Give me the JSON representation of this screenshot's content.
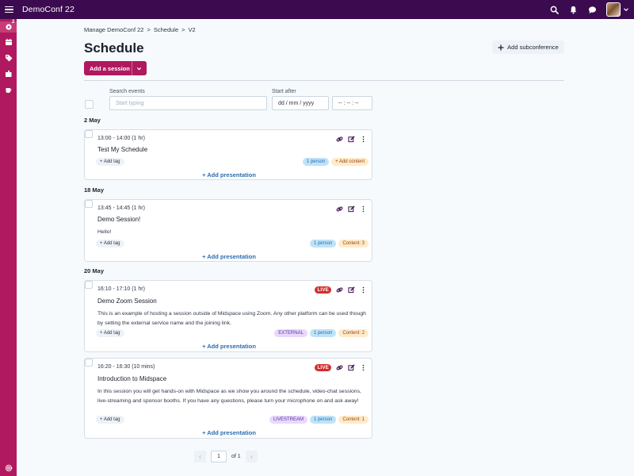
{
  "app": {
    "title": "DemoConf 22"
  },
  "rail": {
    "badge_count": "2"
  },
  "breadcrumb": [
    "Manage DemoConf 22",
    ">",
    "Schedule",
    ">",
    "V2"
  ],
  "page": {
    "title": "Schedule",
    "add_subconference": "Add subconference",
    "add_session": "Add a session"
  },
  "filters": {
    "search_label": "Search events",
    "search_placeholder": "Start typing",
    "start_after_label": "Start after",
    "date_placeholder": "dd / mm / yyyy",
    "time_placeholder": "-- : -- : --"
  },
  "groups": [
    {
      "date": "2 May",
      "sessions": [
        {
          "time": "13:00 - 14:00 (1 hr)",
          "title": "Test My Schedule",
          "description": "",
          "add_tag": "+ Add tag",
          "pills": [
            "1 person",
            "+ Add content"
          ],
          "add_presentation": "Add presentation"
        }
      ]
    },
    {
      "date": "18 May",
      "sessions": [
        {
          "time": "13:45 - 14:45 (1 hr)",
          "title": "Demo Session!",
          "description": "Hello!",
          "add_tag": "+ Add tag",
          "pills": [
            "1 person",
            "Content: 3"
          ],
          "add_presentation": "Add presentation"
        }
      ]
    },
    {
      "date": "20 May",
      "sessions": [
        {
          "time": "16:10 - 17:10 (1 hr)",
          "title": "Demo Zoom Session",
          "live": "LIVE",
          "description": "This is an example of hosting a session outside of Midspace using Zoom. Any other platform can be used though by setting the external service name and the joining link.",
          "add_tag": "+ Add tag",
          "pills": [
            "EXTERNAL",
            "1 person",
            "Content: 2"
          ],
          "add_presentation": "Add presentation"
        },
        {
          "time": "16:20 - 16:30 (10 mins)",
          "title": "Introduction to Midspace",
          "live": "LIVE",
          "description": "In this session you will get hands-on with Midspace as we show you around the schedule, video-chat sessions, live-streaming and sponsor booths. If you have any questions, please turn your microphone on and ask away!",
          "add_tag": "+ Add tag",
          "pills": [
            "LIVESTREAM",
            "1 person",
            "Content: 1"
          ],
          "add_presentation": "Add presentation"
        }
      ]
    }
  ],
  "pagination": {
    "prev": "‹",
    "page": "1",
    "of": "of 1",
    "next": "›"
  },
  "colors": {
    "topbar": "#3c0b4f",
    "rail": "#b0195f",
    "primary_button": "#b0195f",
    "live": "#d22e2e",
    "link": "#2b6cb0"
  }
}
